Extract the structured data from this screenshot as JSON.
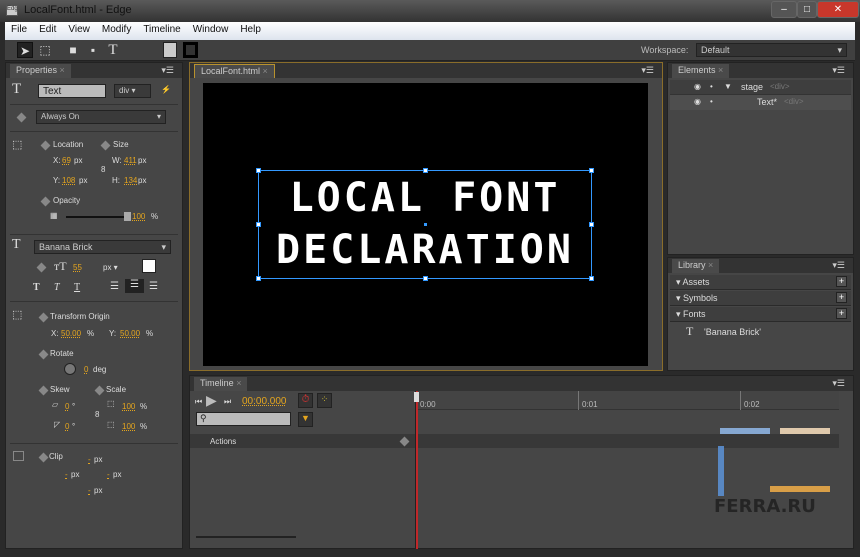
{
  "window": {
    "title": "LocalFont.html - Edge",
    "app_icon": "Edg",
    "minimize": "–",
    "maximize": "□",
    "close": "✕"
  },
  "menu": [
    "File",
    "Edit",
    "View",
    "Modify",
    "Timeline",
    "Window",
    "Help"
  ],
  "workspace": {
    "label": "Workspace:",
    "value": "Default"
  },
  "properties": {
    "tab": "Properties",
    "name": "Text",
    "tag": "div",
    "visibility": "Always On",
    "location_label": "Location",
    "size_label": "Size",
    "x_label": "X:",
    "x": "69",
    "y_label": "Y:",
    "y": "108",
    "w_label": "W:",
    "w": "411",
    "h_label": "H:",
    "h": "134",
    "px": "px",
    "opacity_label": "Opacity",
    "opacity": "100",
    "pct": "%",
    "opacity_fraction": 1.0,
    "font": "Banana Brick",
    "font_size": "55",
    "font_unit": "px",
    "text_color": "#ffffff",
    "transform_origin_label": "Transform Origin",
    "origin_x": "50.00",
    "origin_y": "50.00",
    "rotate_label": "Rotate",
    "rotate": "0",
    "deg": "deg",
    "skew_label": "Skew",
    "skew_x": "0",
    "skew_y": "0",
    "degsym": "°",
    "scale_label": "Scale",
    "scale_x": "100",
    "scale_y": "100",
    "clip_label": "Clip",
    "clip_val": "-"
  },
  "stage": {
    "tab": "LocalFont.html",
    "line1": "LOCAL FONT",
    "line2": "DECLARATION"
  },
  "elements": {
    "tab": "Elements",
    "rows": [
      {
        "name": "stage",
        "tag": "<div>"
      },
      {
        "name": "Text*",
        "tag": "<div>"
      }
    ]
  },
  "library": {
    "tab": "Library",
    "sections": [
      "Assets",
      "Symbols",
      "Fonts"
    ],
    "font_item": "'Banana Brick'"
  },
  "timeline": {
    "tab": "Timeline",
    "time": "00:00.000",
    "ticks": [
      "0:00",
      "0:01",
      "0:02"
    ],
    "actions": "Actions"
  },
  "watermark": "FERRA.RU",
  "colors": {
    "accent": "#e4a51e",
    "playhead": "#c0282a"
  }
}
